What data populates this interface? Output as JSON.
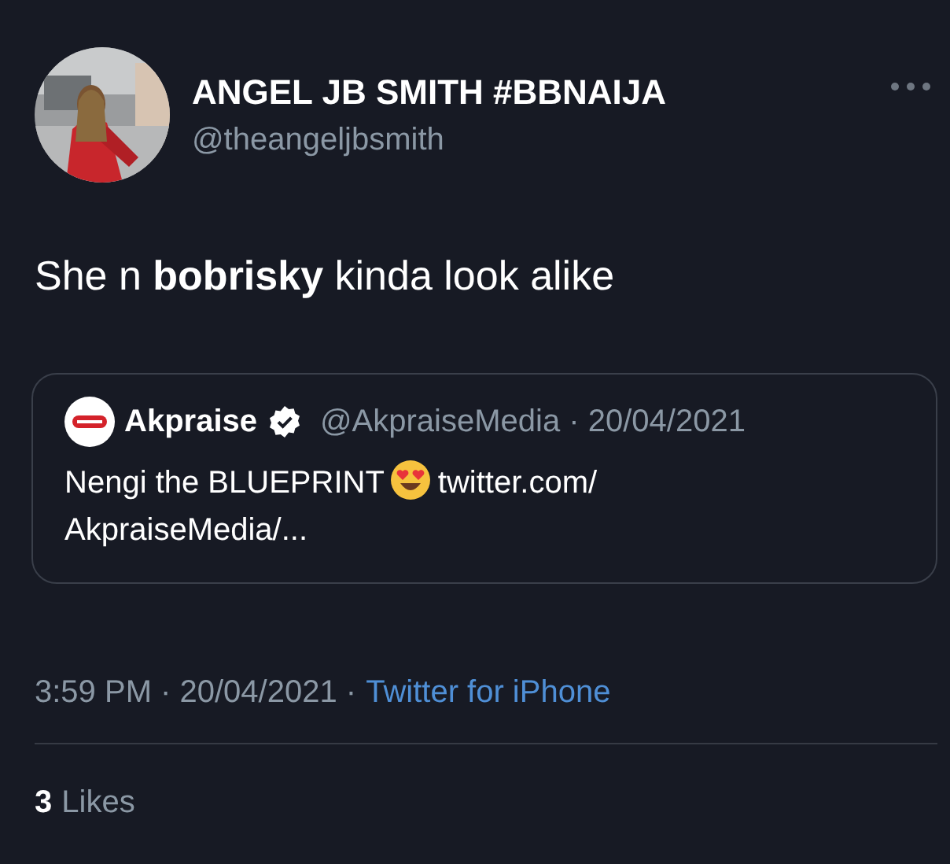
{
  "author": {
    "name": "ANGEL JB SMITH #BBNAIJA",
    "handle": "@theangeljbsmith"
  },
  "text": "She n **bobrisky** kinda look alike",
  "quote": {
    "name": "Akpraise",
    "verified": true,
    "handle_date": "@AkpraiseMedia · 20/04/2021",
    "text": "Nengi the BLUEPRINT",
    "link_lines": [
      "twitter.com/",
      "AkpraiseMedia/..."
    ]
  },
  "meta": "3:59 PM · 20/04/2021 ·",
  "source": "Twitter for iPhone",
  "likes": {
    "count": "3",
    "label": "Likes"
  }
}
